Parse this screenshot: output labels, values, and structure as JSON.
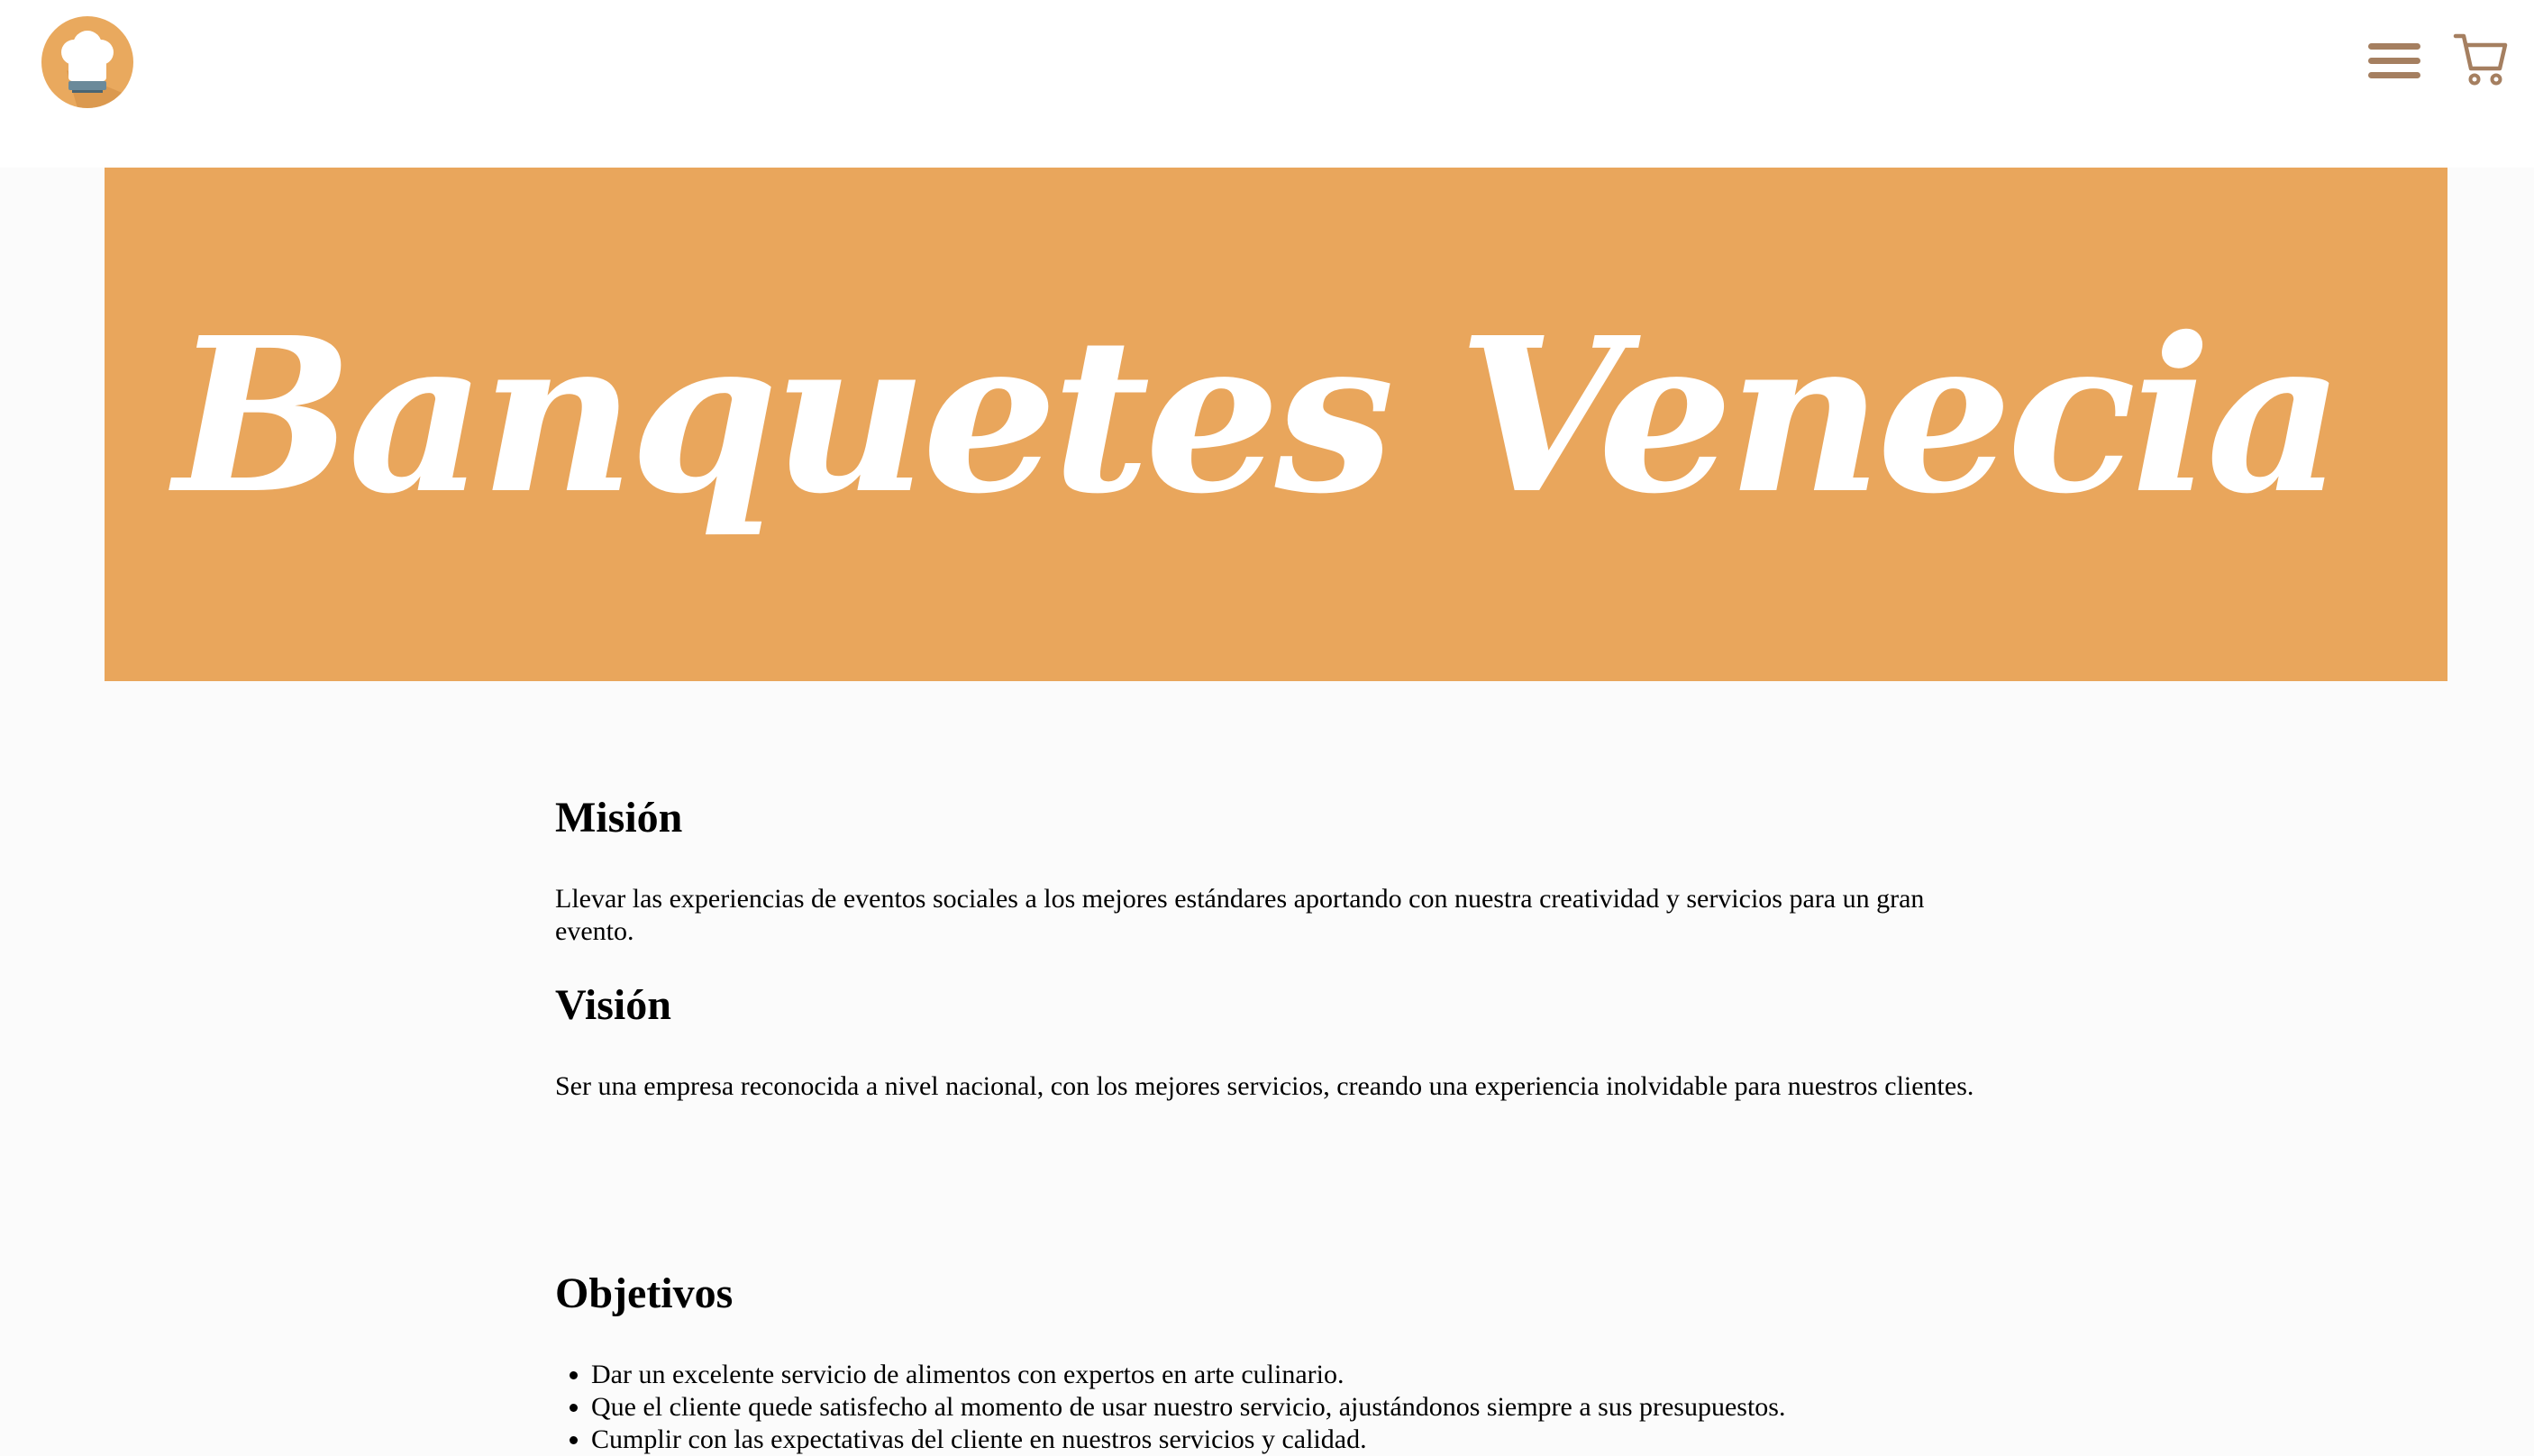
{
  "header": {
    "logo_icon": "chef-hat-icon",
    "menu_icon": "hamburger-menu-icon",
    "cart_icon": "shopping-cart-icon",
    "icon_color": "#a57f60",
    "logo_color": "#e9a95e"
  },
  "hero": {
    "title": "Banquetes Venecia",
    "background": "#e9a65c"
  },
  "mision": {
    "title": "Misión",
    "text": "Llevar las experiencias de eventos sociales a los mejores estándares aportando con nuestra creatividad y servicios para un gran evento."
  },
  "vision": {
    "title": "Visión",
    "text": "Ser una empresa reconocida a nivel nacional, con los mejores servicios, creando una experiencia inolvidable para nuestros clientes."
  },
  "objetivos": {
    "title": "Objetivos",
    "items": [
      "Dar un excelente servicio de alimentos con expertos en arte culinario.",
      "Que el cliente quede satisfecho al momento de usar nuestro servicio, ajustándonos siempre a sus presupuestos.",
      "Cumplir con las expectativas del cliente en nuestros servicios y calidad."
    ]
  }
}
